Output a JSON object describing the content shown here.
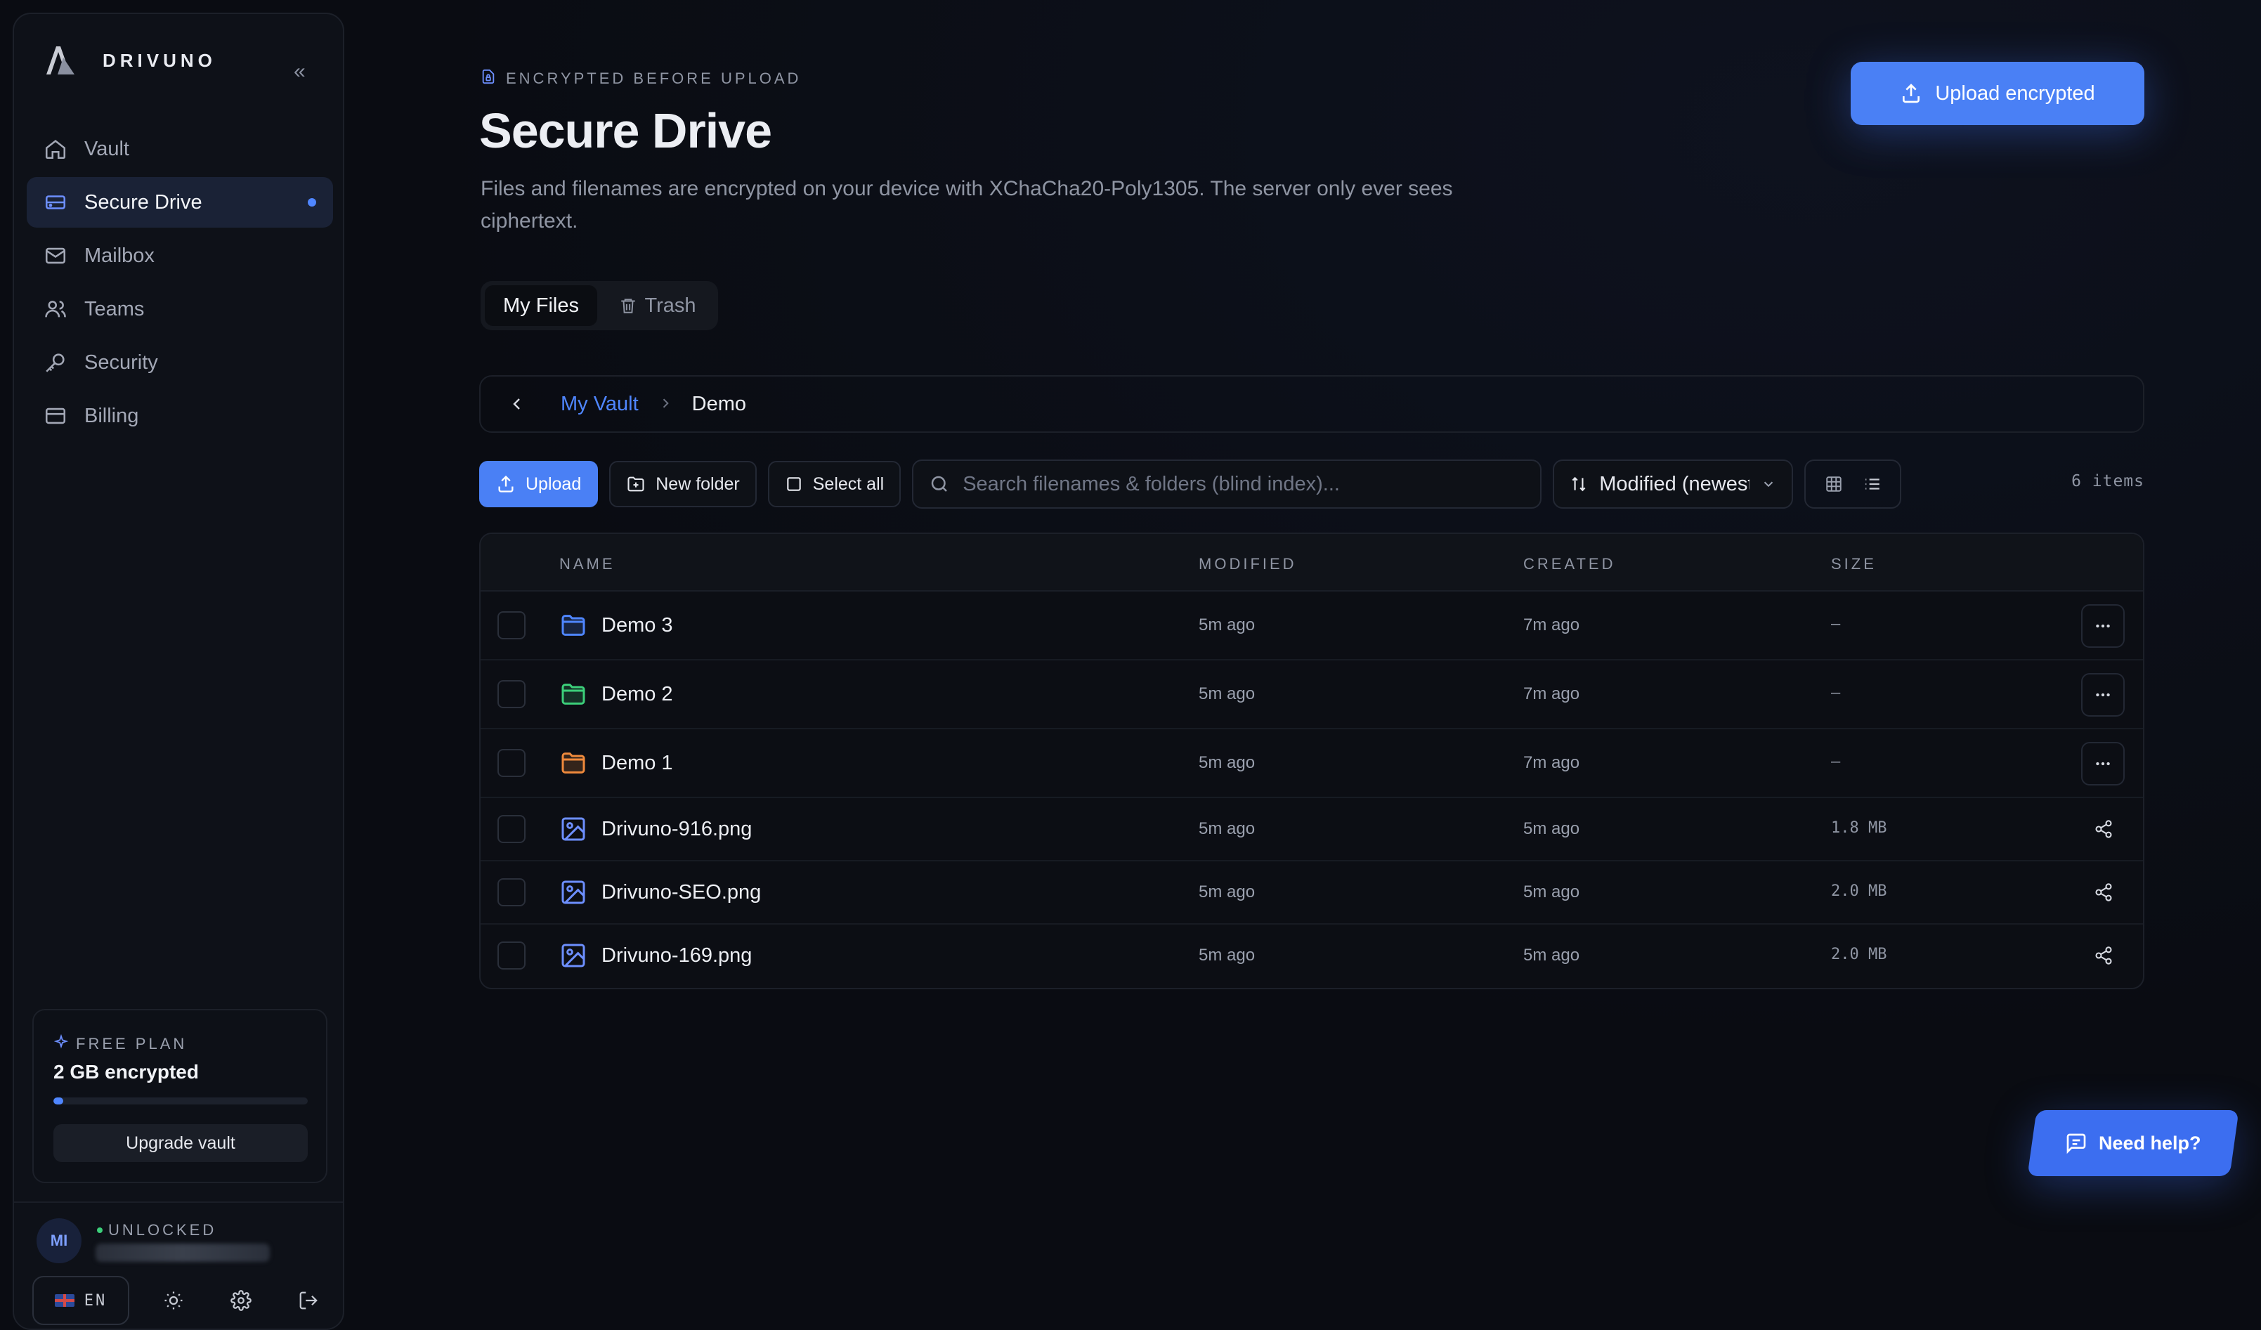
{
  "brand": {
    "name": "DRIVUNO"
  },
  "sidebar": {
    "items": [
      {
        "label": "Vault",
        "icon": "home-icon"
      },
      {
        "label": "Secure Drive",
        "icon": "drive-icon",
        "active": true
      },
      {
        "label": "Mailbox",
        "icon": "mail-icon"
      },
      {
        "label": "Teams",
        "icon": "users-icon"
      },
      {
        "label": "Security",
        "icon": "key-icon"
      },
      {
        "label": "Billing",
        "icon": "card-icon"
      }
    ],
    "plan": {
      "tag": "FREE PLAN",
      "size": "2 GB encrypted",
      "usage_fraction": 0.04,
      "upgrade_label": "Upgrade vault"
    },
    "user": {
      "initials": "MI",
      "status": "UNLOCKED"
    },
    "lang": "EN"
  },
  "header": {
    "eyebrow": "ENCRYPTED BEFORE UPLOAD",
    "title": "Secure Drive",
    "subtitle": "Files and filenames are encrypted on your device with XChaCha20-Poly1305. The server only ever sees ciphertext.",
    "upload_button": "Upload encrypted"
  },
  "tabs": [
    {
      "label": "My Files",
      "active": true
    },
    {
      "label": "Trash"
    }
  ],
  "breadcrumb": {
    "parent": "My Vault",
    "current": "Demo"
  },
  "toolbar": {
    "upload": "Upload",
    "new_folder": "New folder",
    "select_all": "Select all",
    "search_placeholder": "Search filenames & folders (blind index)...",
    "sort": "Modified (newest)",
    "count": "6 items"
  },
  "table": {
    "columns": [
      "NAME",
      "MODIFIED",
      "CREATED",
      "SIZE"
    ],
    "rows": [
      {
        "type": "folder",
        "name": "Demo 3",
        "modified": "5m ago",
        "created": "7m ago",
        "size": "—",
        "color": "#4f86ff"
      },
      {
        "type": "folder",
        "name": "Demo 2",
        "modified": "5m ago",
        "created": "7m ago",
        "size": "—",
        "color": "#3ccf7a"
      },
      {
        "type": "folder",
        "name": "Demo 1",
        "modified": "5m ago",
        "created": "7m ago",
        "size": "—",
        "color": "#f08a3c"
      },
      {
        "type": "file",
        "name": "Drivuno-916.png",
        "modified": "5m ago",
        "created": "5m ago",
        "size": "1.8 MB"
      },
      {
        "type": "file",
        "name": "Drivuno-SEO.png",
        "modified": "5m ago",
        "created": "5m ago",
        "size": "2.0 MB"
      },
      {
        "type": "file",
        "name": "Drivuno-169.png",
        "modified": "5m ago",
        "created": "5m ago",
        "size": "2.0 MB"
      }
    ]
  },
  "help": {
    "label": "Need help?"
  },
  "colors": {
    "accent": "#4a80f5",
    "background": "#0a0c12",
    "sidebar": "#0e1118"
  }
}
